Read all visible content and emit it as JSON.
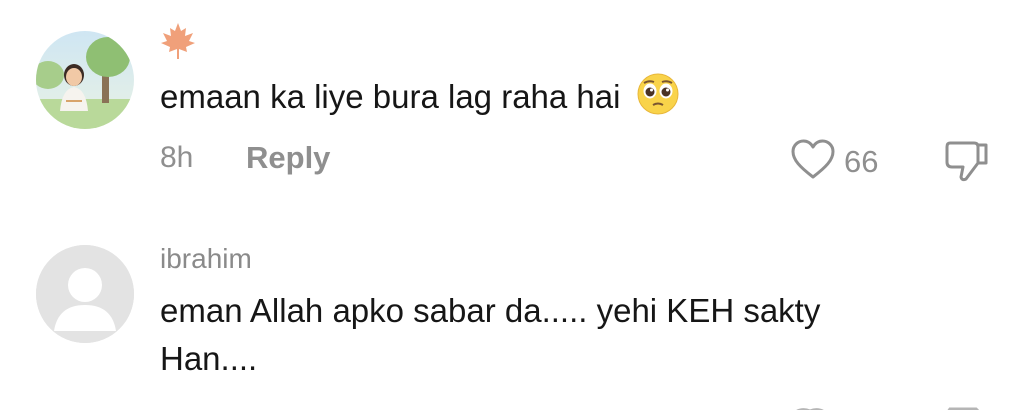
{
  "comments": [
    {
      "username_glyph": "maple-leaf-icon",
      "avatar": "illustrated-girl-avatar",
      "text": "emaan ka liye bura lag raha hai",
      "emoji": "pleading-face-emoji",
      "time": "8h",
      "reply_label": "Reply",
      "likes": "66"
    },
    {
      "username": "ibrahim",
      "avatar": "default-avatar",
      "text_line1": "eman Allah apko sabar da..... yehi KEH sakty",
      "text_line2": "Han...."
    }
  ],
  "colors": {
    "muted": "#8f8f8f",
    "text": "#161616",
    "leaf": "#f0a07a",
    "default_avatar_bg": "#e3e3e3"
  }
}
